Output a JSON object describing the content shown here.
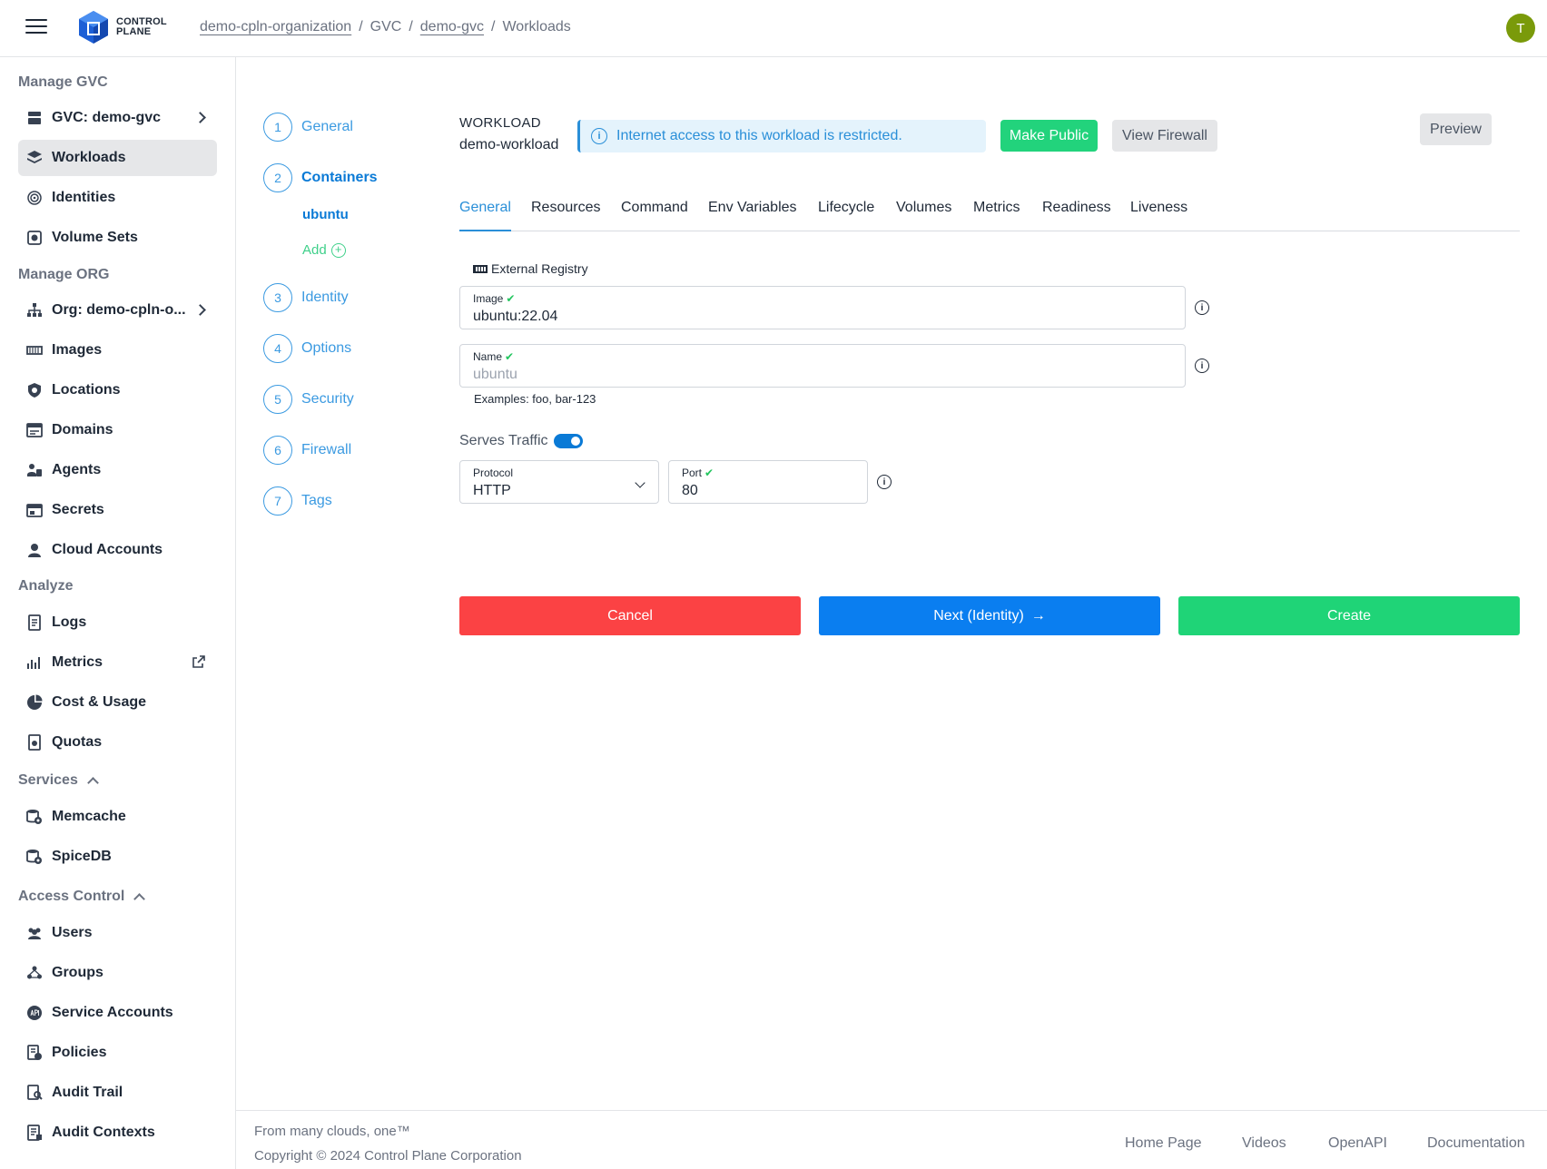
{
  "header": {
    "logo_line1": "CONTROL",
    "logo_line2": "PLANE",
    "breadcrumb": [
      "demo-cpln-organization",
      "GVC",
      "demo-gvc",
      "Workloads"
    ],
    "breadcrumb_sep": "/",
    "avatar_initial": "T",
    "avatar_color": "#7a9a0a"
  },
  "sidebar": {
    "sections": {
      "manage_gvc": "Manage GVC",
      "manage_org": "Manage ORG",
      "analyze": "Analyze",
      "services": "Services",
      "access_control": "Access Control"
    },
    "items": {
      "gvc": "GVC: demo-gvc",
      "workloads": "Workloads",
      "identities": "Identities",
      "volume_sets": "Volume Sets",
      "org": "Org: demo-cpln-o...",
      "images": "Images",
      "locations": "Locations",
      "domains": "Domains",
      "agents": "Agents",
      "secrets": "Secrets",
      "cloud_accounts": "Cloud Accounts",
      "logs": "Logs",
      "metrics": "Metrics",
      "cost_usage": "Cost & Usage",
      "quotas": "Quotas",
      "memcache": "Memcache",
      "spicedb": "SpiceDB",
      "users": "Users",
      "groups": "Groups",
      "service_accounts": "Service Accounts",
      "policies": "Policies",
      "audit_trail": "Audit Trail",
      "audit_contexts": "Audit Contexts"
    }
  },
  "stepper": {
    "steps": [
      {
        "num": "1",
        "label": "General"
      },
      {
        "num": "2",
        "label": "Containers"
      },
      {
        "num": "3",
        "label": "Identity"
      },
      {
        "num": "4",
        "label": "Options"
      },
      {
        "num": "5",
        "label": "Security"
      },
      {
        "num": "6",
        "label": "Firewall"
      },
      {
        "num": "7",
        "label": "Tags"
      }
    ],
    "container_name": "ubuntu",
    "add_label": "Add"
  },
  "workload": {
    "title": "WORKLOAD",
    "name": "demo-workload",
    "banner_text": "Internet access to this workload is restricted.",
    "make_public": "Make Public",
    "view_firewall": "View Firewall",
    "preview": "Preview"
  },
  "tabs": [
    "General",
    "Resources",
    "Command",
    "Env Variables",
    "Lifecycle",
    "Volumes",
    "Metrics",
    "Readiness",
    "Liveness"
  ],
  "form": {
    "registry_label": "External Registry",
    "image_label": "Image",
    "image_value": "ubuntu:22.04",
    "name_label": "Name",
    "name_placeholder": "ubuntu",
    "name_hint": "Examples: foo, bar-123",
    "serves_traffic_label": "Serves Traffic",
    "serves_traffic_on": true,
    "protocol_label": "Protocol",
    "protocol_value": "HTTP",
    "port_label": "Port",
    "port_value": "80",
    "check": "✔"
  },
  "actions": {
    "cancel": "Cancel",
    "next": "Next (Identity)",
    "create": "Create"
  },
  "footer": {
    "tagline": "From many clouds, one™",
    "copyright": "Copyright © 2024 Control Plane Corporation",
    "links": [
      "Home Page",
      "Videos",
      "OpenAPI",
      "Documentation"
    ]
  },
  "colors": {
    "primary_blue": "#0a7ef0",
    "step_blue": "#3b9ae1",
    "green": "#22d37c",
    "red": "#fb4244"
  }
}
